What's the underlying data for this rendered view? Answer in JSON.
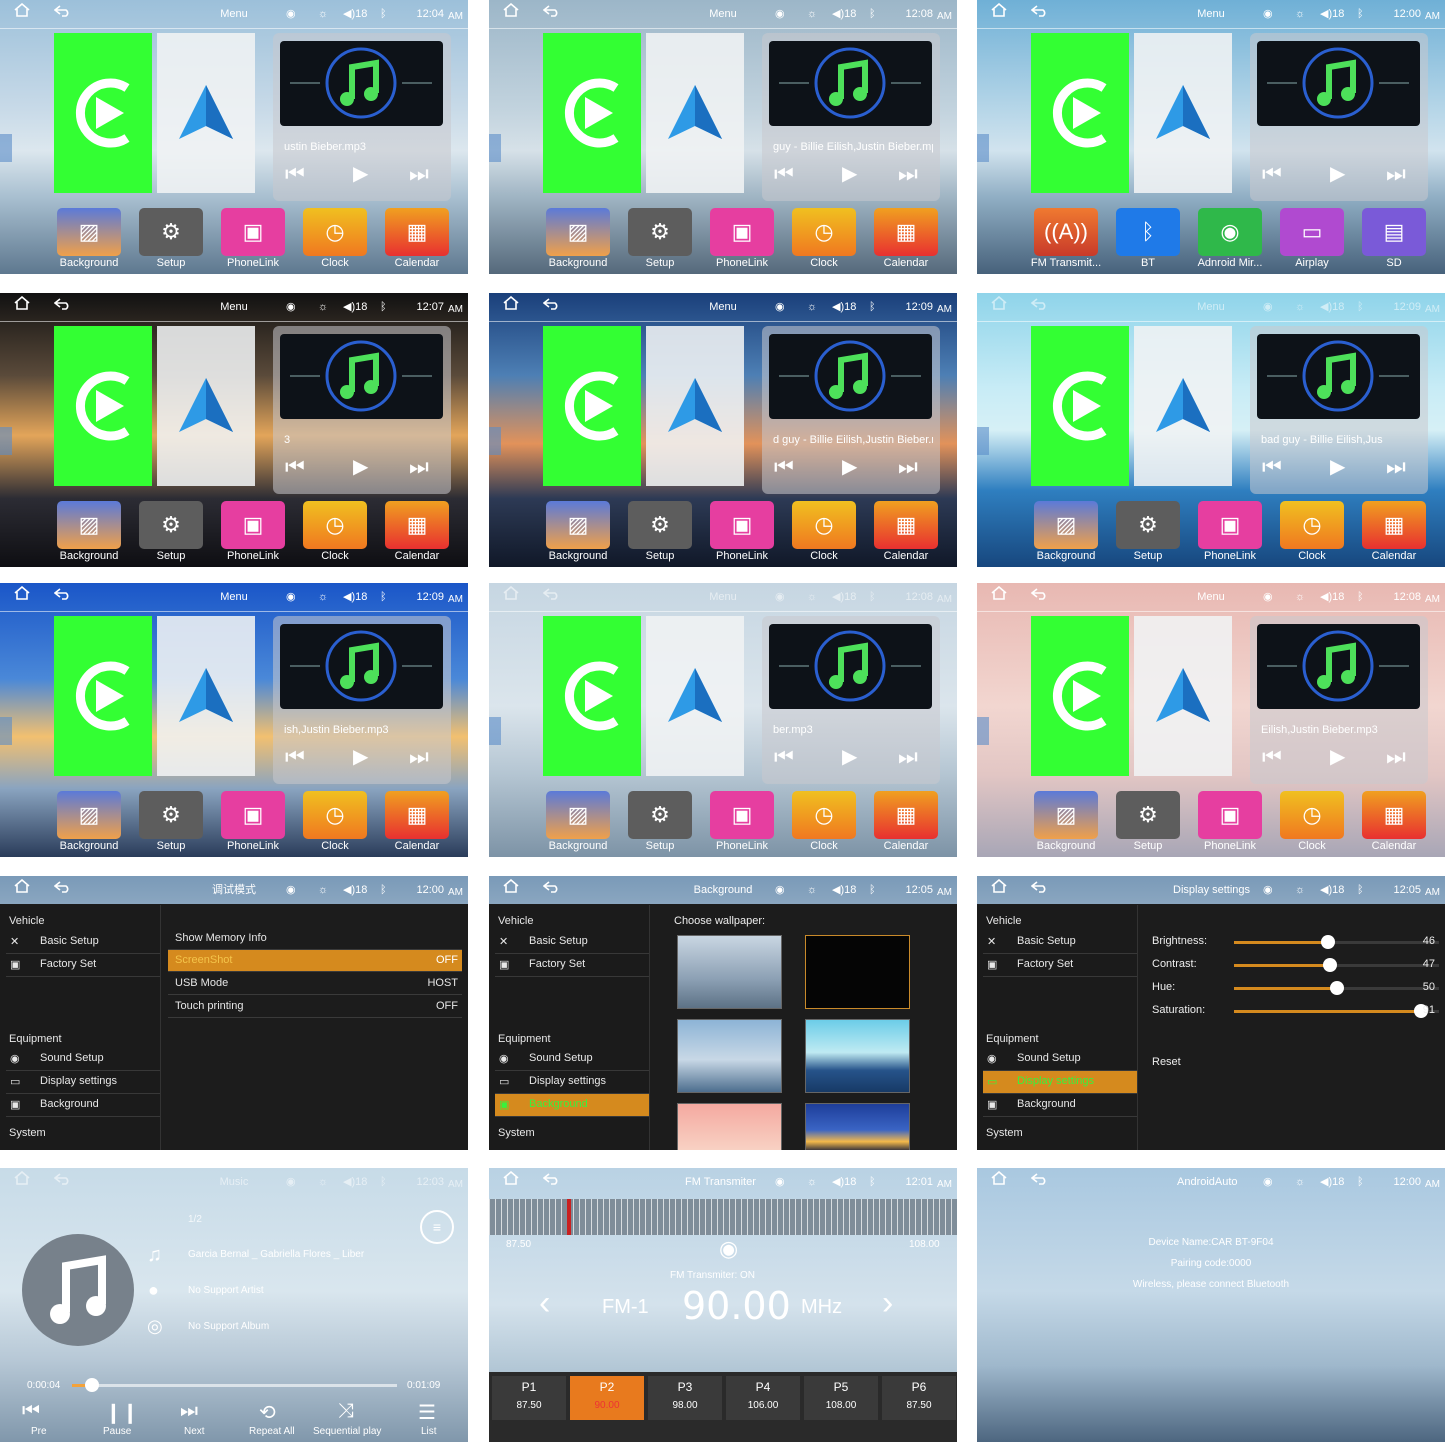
{
  "common": {
    "icons": {
      "home": "home-icon",
      "back": "back-icon",
      "cast": "broadcast-icon",
      "brightness": "sun-icon",
      "volume": "volume-icon",
      "bluetooth": "bluetooth-icon"
    },
    "volume": "18",
    "ampm": "AM",
    "colors": {
      "accent": "#d58a1e",
      "carplay_green": "#33ff33",
      "active_text": "#39f23c"
    }
  },
  "panels": [
    {
      "id": "p1",
      "title": "Menu",
      "time": "12:04",
      "song": "ustin Bieber.mp3",
      "apps": [
        "Background",
        "Setup",
        "PhoneLink",
        "Clock",
        "Calendar"
      ]
    },
    {
      "id": "p2",
      "title": "Menu",
      "time": "12:08",
      "song": "guy - Billie Eilish,Justin Bieber.mp",
      "apps": [
        "Background",
        "Setup",
        "PhoneLink",
        "Clock",
        "Calendar"
      ]
    },
    {
      "id": "p3",
      "title": "Menu",
      "time": "12:00",
      "song": "",
      "apps": [
        "FM Transmit...",
        "BT",
        "Adnroid Mir...",
        "Airplay",
        "SD"
      ]
    },
    {
      "id": "p4",
      "title": "Menu",
      "time": "12:07",
      "song": "3",
      "apps": [
        "Background",
        "Setup",
        "PhoneLink",
        "Clock",
        "Calendar"
      ]
    },
    {
      "id": "p5",
      "title": "Menu",
      "time": "12:09",
      "song": "d guy - Billie Eilish,Justin Bieber.n",
      "apps": [
        "Background",
        "Setup",
        "PhoneLink",
        "Clock",
        "Calendar"
      ]
    },
    {
      "id": "p6",
      "title": "Menu",
      "time": "12:09",
      "song": "bad guy - Billie Eilish,Jus",
      "apps": [
        "Background",
        "Setup",
        "PhoneLink",
        "Clock",
        "Calendar"
      ]
    },
    {
      "id": "p7",
      "title": "Menu",
      "time": "12:09",
      "song": "ish,Justin Bieber.mp3",
      "apps": [
        "Background",
        "Setup",
        "PhoneLink",
        "Clock",
        "Calendar"
      ]
    },
    {
      "id": "p8",
      "title": "Menu",
      "time": "12:08",
      "song": "ber.mp3",
      "apps": [
        "Background",
        "Setup",
        "PhoneLink",
        "Clock",
        "Calendar"
      ]
    },
    {
      "id": "p9",
      "title": "Menu",
      "time": "12:08",
      "song": "Eilish,Justin Bieber.mp3",
      "apps": [
        "Background",
        "Setup",
        "PhoneLink",
        "Clock",
        "Calendar"
      ]
    }
  ],
  "debug": {
    "title": "调试模式",
    "time": "12:00",
    "sidebar": {
      "vehicle": "Vehicle",
      "basic": "Basic Setup",
      "factory": "Factory Set",
      "equipment": "Equipment",
      "sound": "Sound Setup",
      "display": "Display settings",
      "background": "Background",
      "system": "System"
    },
    "rows": [
      {
        "k": "Show Memory Info",
        "v": ""
      },
      {
        "k": "ScreenShot",
        "v": "OFF"
      },
      {
        "k": "USB Mode",
        "v": "HOST"
      },
      {
        "k": "Touch printing",
        "v": "OFF"
      }
    ]
  },
  "bg_settings": {
    "title": "Background",
    "time": "12:05",
    "heading": "Choose wallpaper:"
  },
  "display_settings": {
    "title": "Display settings",
    "time": "12:05",
    "sliders": [
      {
        "label": "Brightness:",
        "value": 46
      },
      {
        "label": "Contrast:",
        "value": 47
      },
      {
        "label": "Hue:",
        "value": 50
      },
      {
        "label": "Saturation:",
        "value": 91
      }
    ],
    "reset": "Reset"
  },
  "music": {
    "title": "Music",
    "time": "12:03",
    "index": "1/2",
    "track": "Garcia Bernal _ Gabriella Flores _ Liber",
    "artist": "No Support Artist",
    "album": "No Support Album",
    "elapsed": "0:00:04",
    "total": "0:01:09",
    "progress": 0.06,
    "controls": [
      "Pre",
      "Pause",
      "Next",
      "Repeat All",
      "Sequential play",
      "List"
    ]
  },
  "fm": {
    "title": "FM Transmiter",
    "time": "12:01",
    "min": "87.50",
    "max": "108.00",
    "status": "FM Transmiter:  ON",
    "band": "FM-1",
    "freq": "90.00",
    "unit": "MHz",
    "presets": [
      {
        "p": "P1",
        "f": "87.50"
      },
      {
        "p": "P2",
        "f": "90.00"
      },
      {
        "p": "P3",
        "f": "98.00"
      },
      {
        "p": "P4",
        "f": "106.00"
      },
      {
        "p": "P5",
        "f": "108.00"
      },
      {
        "p": "P6",
        "f": "87.50"
      }
    ]
  },
  "aa": {
    "title": "AndroidAuto",
    "time": "12:00",
    "line1": "Device Name:CAR BT-9F04",
    "line2": "Pairing code:0000",
    "line3": "Wireless, please connect Bluetooth"
  }
}
